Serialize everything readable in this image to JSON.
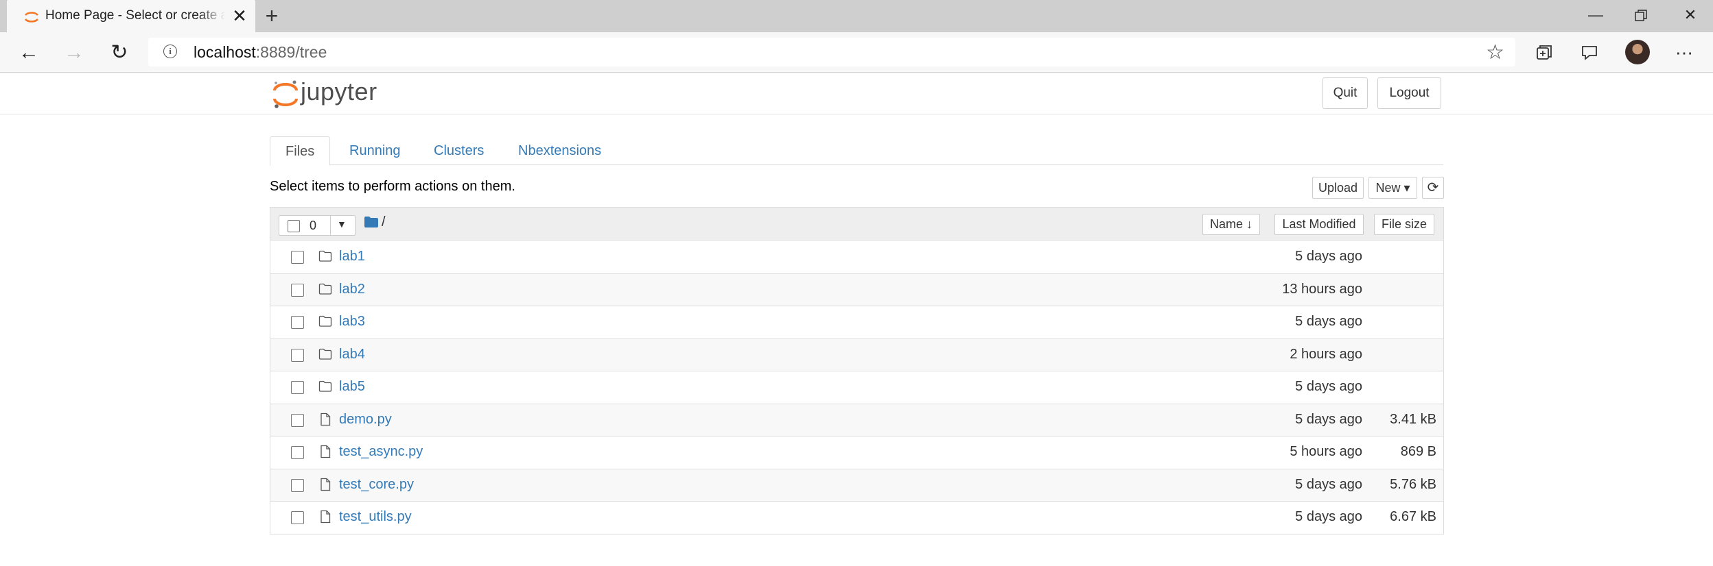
{
  "browser": {
    "tab_title": "Home Page - Select or create a notebook",
    "url_host": "localhost",
    "url_rest": ":8889/tree",
    "new_tab_glyph": "+",
    "close_glyph": "✕"
  },
  "header": {
    "logo_text": "jupyter",
    "quit_label": "Quit",
    "logout_label": "Logout"
  },
  "tabs": [
    {
      "label": "Files",
      "active": true
    },
    {
      "label": "Running",
      "active": false
    },
    {
      "label": "Clusters",
      "active": false
    },
    {
      "label": "Nbextensions",
      "active": false
    }
  ],
  "toolbar": {
    "hint": "Select items to perform actions on them.",
    "upload_label": "Upload",
    "new_label": "New ▾",
    "refresh_icon": "refresh-icon"
  },
  "list_header": {
    "selected_count": "0",
    "breadcrumb": "/",
    "sort_name_label": "Name ↓",
    "sort_modified_label": "Last Modified",
    "sort_size_label": "File size"
  },
  "items": [
    {
      "name": "lab1",
      "type": "folder",
      "modified": "5 days ago",
      "size": ""
    },
    {
      "name": "lab2",
      "type": "folder",
      "modified": "13 hours ago",
      "size": ""
    },
    {
      "name": "lab3",
      "type": "folder",
      "modified": "5 days ago",
      "size": ""
    },
    {
      "name": "lab4",
      "type": "folder",
      "modified": "2 hours ago",
      "size": ""
    },
    {
      "name": "lab5",
      "type": "folder",
      "modified": "5 days ago",
      "size": ""
    },
    {
      "name": "demo.py",
      "type": "file",
      "modified": "5 days ago",
      "size": "3.41 kB"
    },
    {
      "name": "test_async.py",
      "type": "file",
      "modified": "5 hours ago",
      "size": "869 B"
    },
    {
      "name": "test_core.py",
      "type": "file",
      "modified": "5 days ago",
      "size": "5.76 kB"
    },
    {
      "name": "test_utils.py",
      "type": "file",
      "modified": "5 days ago",
      "size": "6.67 kB"
    }
  ],
  "colors": {
    "link": "#337ab7",
    "jupyter_orange": "#f37726"
  }
}
